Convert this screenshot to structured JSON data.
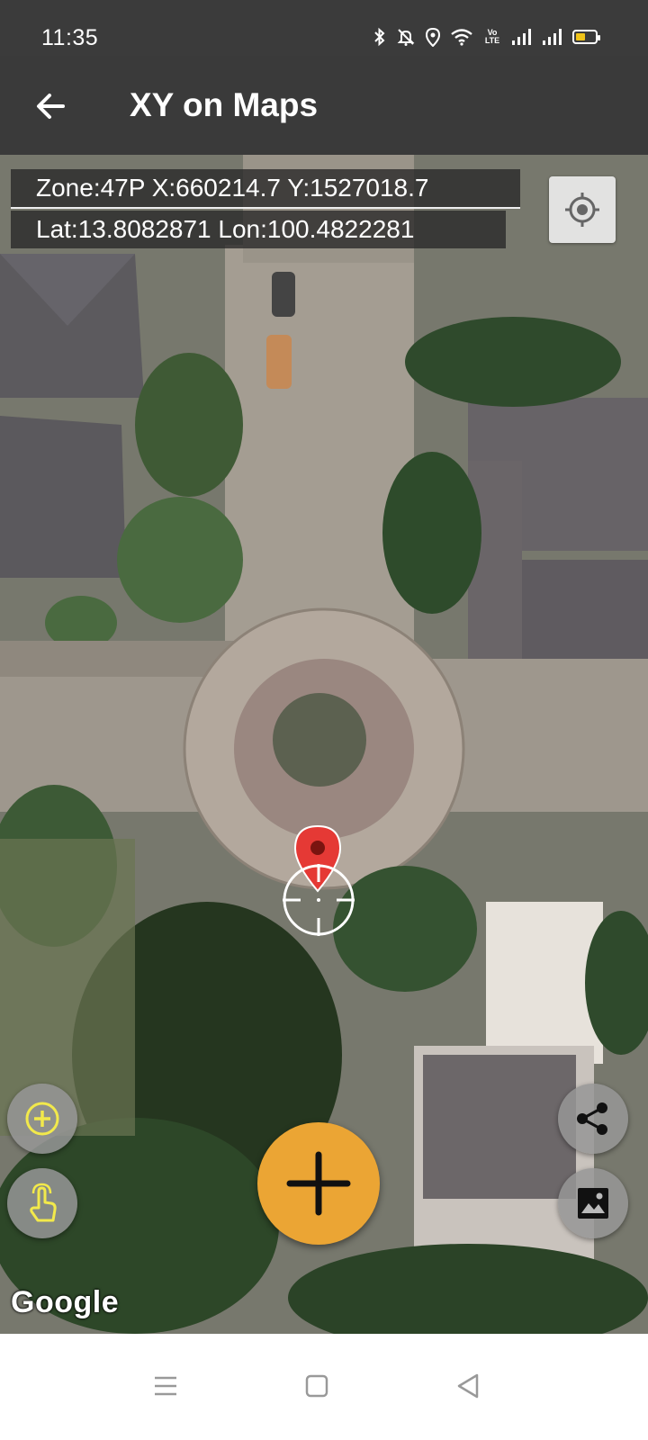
{
  "status_bar": {
    "time": "11:35",
    "volte_label": "Vo LTE",
    "battery_color": "#f0c419",
    "icons": [
      "bluetooth-icon",
      "bell-off-icon",
      "location-icon",
      "wifi-icon",
      "volte-icon",
      "signal-1-icon",
      "signal-2-icon",
      "battery-icon"
    ]
  },
  "app_bar": {
    "title": "XY on Maps",
    "back_icon": "arrow-left-icon"
  },
  "coordinates": {
    "utm_line": "Zone:47P X:660214.7 Y:1527018.7",
    "latlon_line": "Lat:13.8082871 Lon:100.4822281"
  },
  "map": {
    "attribution": "Google",
    "marker_color": "#e53935",
    "type": "satellite"
  },
  "buttons": {
    "locate": "my-location-icon",
    "add_point": "add-circle-icon",
    "touch": "touch-icon",
    "add_main": "plus-icon",
    "add_main_color": "#eba534",
    "share": "share-icon",
    "image": "image-icon"
  },
  "nav_bar": {
    "items": [
      "menu-icon",
      "home-icon",
      "back-icon"
    ]
  }
}
